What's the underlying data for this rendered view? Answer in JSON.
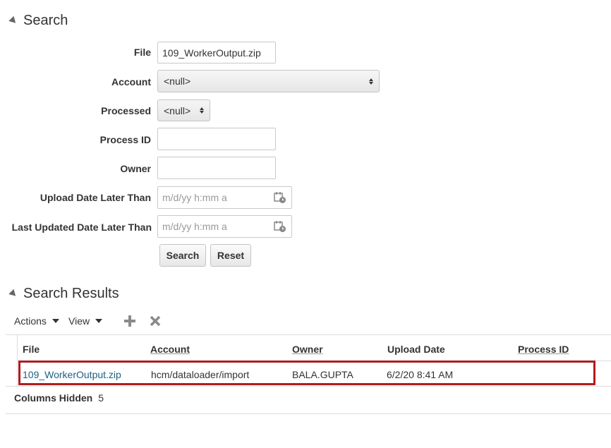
{
  "search": {
    "title": "Search",
    "fields": {
      "file": {
        "label": "File",
        "value": "109_WorkerOutput.zip"
      },
      "account": {
        "label": "Account",
        "value": "<null>"
      },
      "processed": {
        "label": "Processed",
        "value": "<null>"
      },
      "process_id": {
        "label": "Process ID",
        "value": ""
      },
      "owner": {
        "label": "Owner",
        "value": ""
      },
      "upload_date": {
        "label": "Upload Date Later Than",
        "placeholder": "m/d/yy h:mm a"
      },
      "last_updated": {
        "label": "Last Updated Date Later Than",
        "placeholder": "m/d/yy h:mm a"
      }
    },
    "search_button": "Search",
    "reset_button": "Reset"
  },
  "results": {
    "title": "Search Results",
    "toolbar": {
      "actions": "Actions",
      "view": "View"
    },
    "columns": [
      "File",
      "Account",
      "Owner",
      "Upload Date",
      "Process ID"
    ],
    "rows": [
      {
        "file": "109_WorkerOutput.zip",
        "account": "hcm/dataloader/import",
        "owner": "BALA.GUPTA",
        "upload_date": "6/2/20 8:41 AM",
        "process_id": ""
      }
    ],
    "highlight_color": "#b01c1c",
    "columns_hidden": {
      "label": "Columns Hidden",
      "count": "5"
    }
  },
  "colors": {
    "link": "#1f5f85",
    "highlight": "#b01c1c"
  },
  "icons": [
    "disclosure-triangle-icon",
    "calendar-clock-icon",
    "add-icon",
    "delete-icon",
    "dropdown-caret-icon"
  ]
}
